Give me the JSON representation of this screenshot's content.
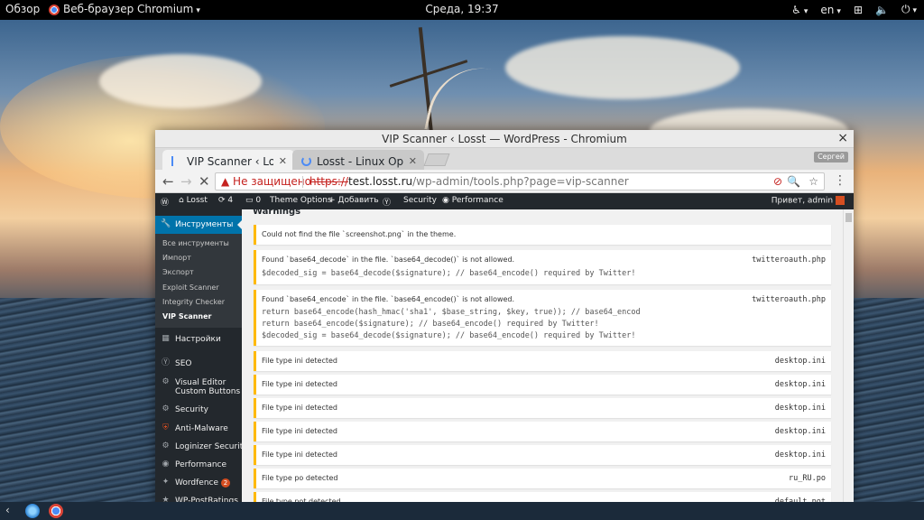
{
  "topbar": {
    "activities": "Обзор",
    "app_name": "Веб-браузер Chromium",
    "clock": "Среда, 19:37",
    "lang": "en"
  },
  "window": {
    "title": "VIP Scanner ‹ Losst — WordPress - Chromium",
    "profile": "Сергей"
  },
  "tabs": [
    {
      "label": "VIP Scanner ‹ Losst"
    },
    {
      "label": "Losst - Linux Open S"
    }
  ],
  "omnibox": {
    "security": "Не защищено",
    "scheme": "https://",
    "host": "test.losst.ru",
    "path": "/wp-admin/tools.php?page=vip-scanner"
  },
  "adminbar": {
    "site": "Losst",
    "updates": "4",
    "comments": "0",
    "theme_options": "Theme Options",
    "add": "Добавить",
    "security": "Security",
    "performance": "Performance",
    "greeting": "Привет, admin"
  },
  "menu": {
    "current": "Инструменты",
    "submenu": [
      "Все инструменты",
      "Импорт",
      "Экспорт",
      "Exploit Scanner",
      "Integrity Checker",
      "VIP Scanner"
    ],
    "items": [
      {
        "label": "Настройки"
      },
      {
        "label": "SEO"
      },
      {
        "label": "Visual Editor",
        "label2": "Custom Buttons"
      },
      {
        "label": "Security"
      },
      {
        "label": "Anti-Malware"
      },
      {
        "label": "Loginizer Security"
      },
      {
        "label": "Performance"
      },
      {
        "label": "Wordfence",
        "badge": "2"
      },
      {
        "label": "WP-PostRatings"
      }
    ]
  },
  "content": {
    "heading": "Warnings",
    "notices": [
      {
        "msg": "Could not find the file `screenshot.png` in the theme.",
        "file": "",
        "code": []
      },
      {
        "msg": "Found `base64_decode` in the file. `base64_decode()` is not allowed.",
        "file": "twitteroauth.php",
        "code": [
          "$decoded_sig = base64_decode($signature); // base64_encode() required by Twitter!"
        ]
      },
      {
        "msg": "Found `base64_encode` in the file. `base64_encode()` is not allowed.",
        "file": "twitteroauth.php",
        "code": [
          "return base64_encode(hash_hmac('sha1', $base_string, $key, true)); // base64_encod",
          "return base64_encode($signature); // base64_encode() required by Twitter!",
          "$decoded_sig = base64_decode($signature); // base64_encode() required by Twitter!"
        ]
      },
      {
        "msg": "File type ini detected",
        "file": "desktop.ini",
        "code": []
      },
      {
        "msg": "File type ini detected",
        "file": "desktop.ini",
        "code": []
      },
      {
        "msg": "File type ini detected",
        "file": "desktop.ini",
        "code": []
      },
      {
        "msg": "File type ini detected",
        "file": "desktop.ini",
        "code": []
      },
      {
        "msg": "File type ini detected",
        "file": "desktop.ini",
        "code": []
      },
      {
        "msg": "File type po detected",
        "file": "ru_RU.po",
        "code": []
      },
      {
        "msg": "File type pot detected",
        "file": "default.pot",
        "code": []
      }
    ]
  }
}
